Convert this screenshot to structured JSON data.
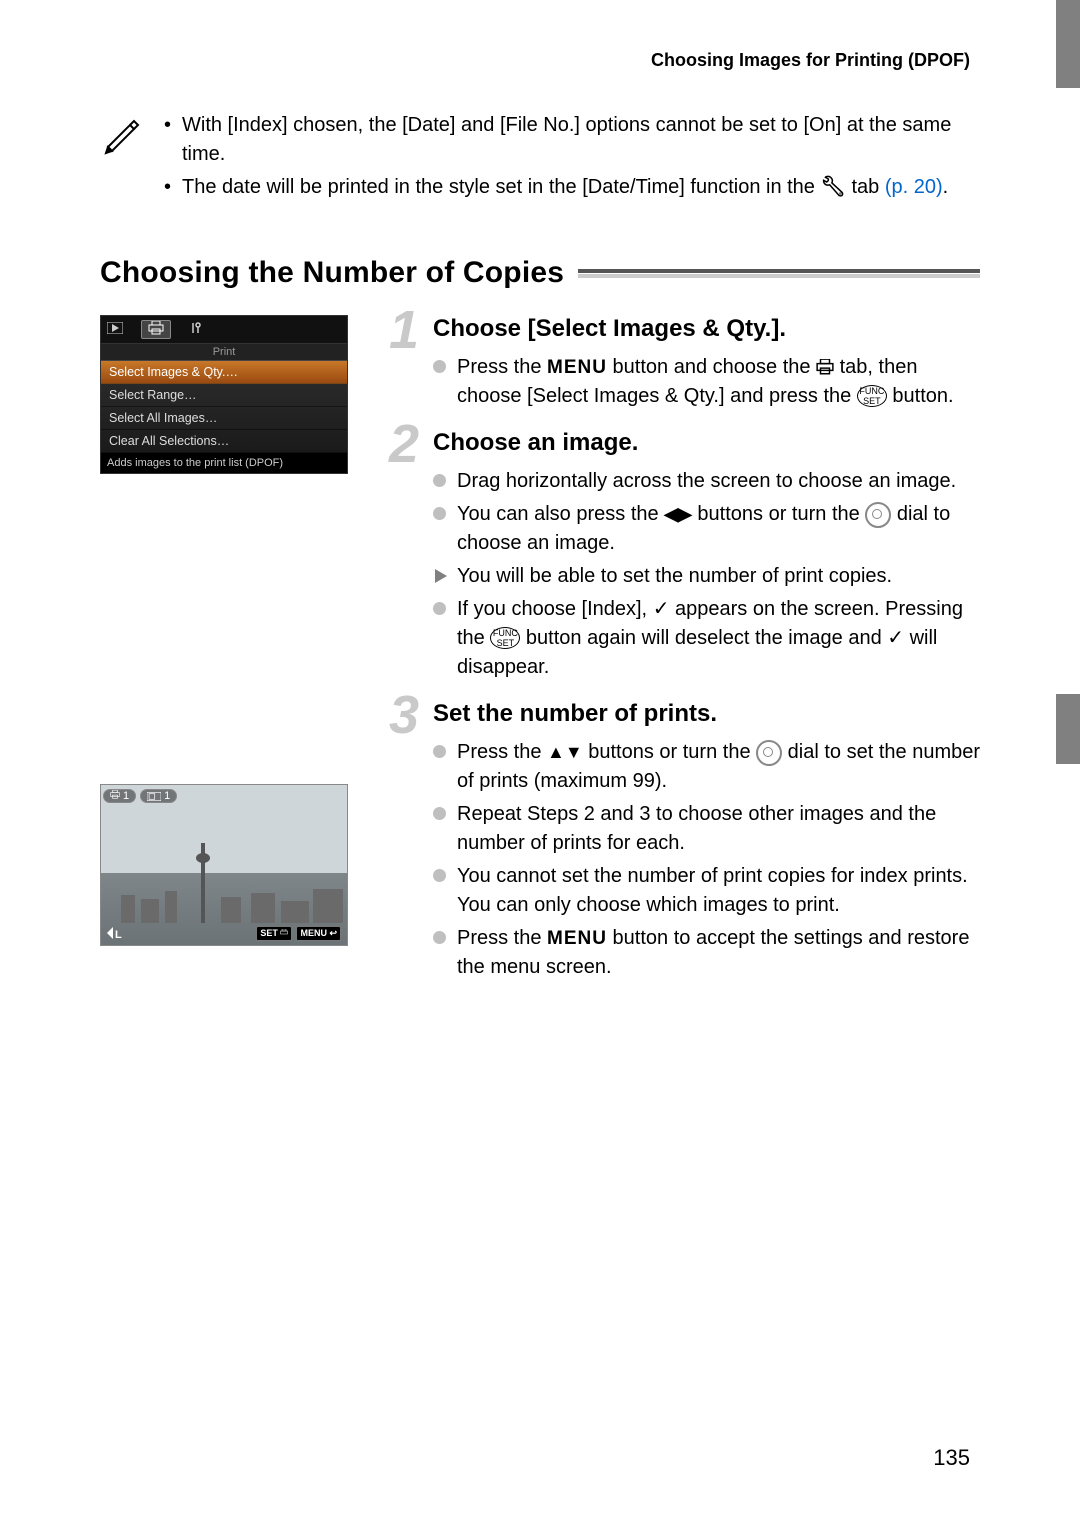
{
  "header": {
    "running_head": "Choosing Images for Printing (DPOF)"
  },
  "note": {
    "item1": "With [Index] chosen, the [Date] and [File No.] options cannot be set to [On] at the same time.",
    "item2_a": "The date will be printed in the style set in the [Date/Time] function in the ",
    "item2_tab": " tab ",
    "item2_ref": "(p. 20)",
    "item2_end": "."
  },
  "section_title": "Choosing the Number of Copies",
  "camera_menu": {
    "header": "Print",
    "items": [
      "Select Images & Qty.…",
      "Select Range…",
      "Select All Images…",
      "Clear All Selections…"
    ],
    "footer": "Adds images to the print list (DPOF)"
  },
  "photo": {
    "count": "1",
    "bl": "L",
    "set": "SET",
    "menu": "MENU"
  },
  "steps": {
    "s1": {
      "num": "1",
      "title": "Choose [Select Images & Qty.].",
      "b1_a": "Press the ",
      "b1_menu": "MENU",
      "b1_b": " button and choose the ",
      "b1_c": " tab, then choose [Select Images & Qty.] and press the ",
      "b1_d": " button."
    },
    "s2": {
      "num": "2",
      "title": "Choose an image.",
      "b1": "Drag horizontally across the screen to choose an image.",
      "b2_a": "You can also press the ",
      "b2_b": " buttons or turn the ",
      "b2_c": " dial to choose an image.",
      "b3": "You will be able to set the number of print copies.",
      "b4_a": "If you choose [Index], ",
      "b4_b": " appears on the screen. Pressing the ",
      "b4_c": " button again will deselect the image and ",
      "b4_d": " will disappear."
    },
    "s3": {
      "num": "3",
      "title": "Set the number of prints.",
      "b1_a": "Press the ",
      "b1_b": " buttons or turn the ",
      "b1_c": " dial to set the number of prints (maximum 99).",
      "b2": "Repeat Steps 2 and 3 to choose other images and the number of prints for each.",
      "b3": "You cannot set the number of print copies for index prints. You can only choose which images to print.",
      "b4_a": "Press the ",
      "b4_menu": "MENU",
      "b4_b": " button to accept the settings and restore the menu screen."
    }
  },
  "page_number": "135"
}
